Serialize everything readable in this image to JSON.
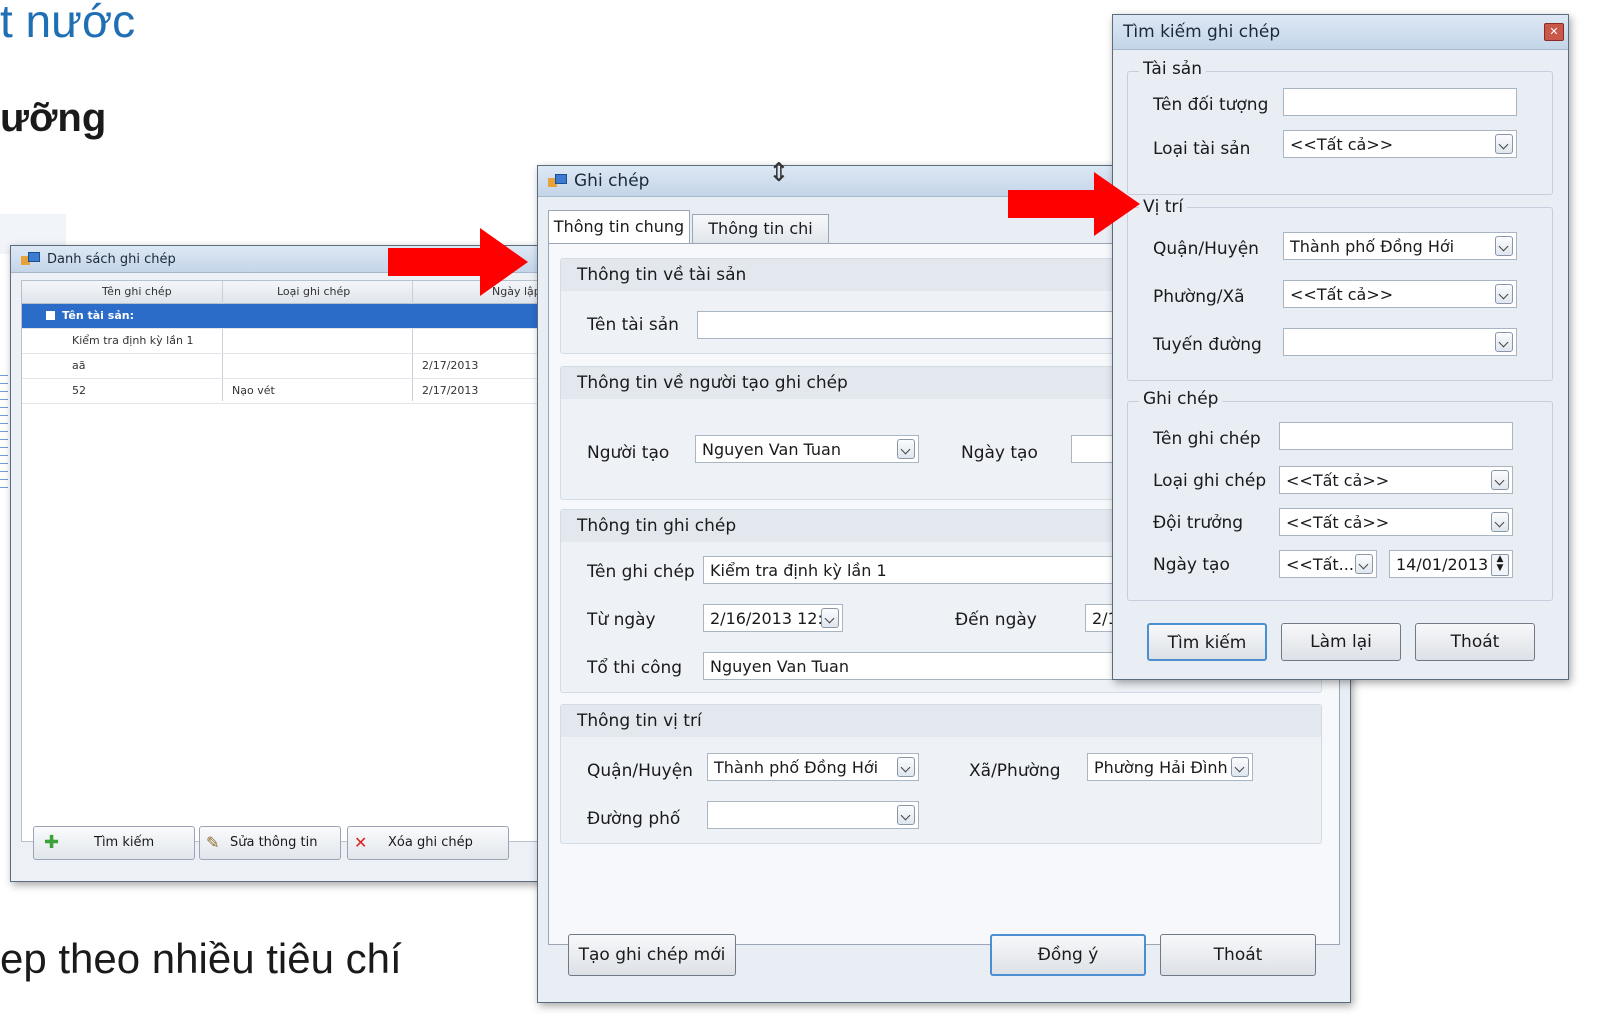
{
  "slide": {
    "title": "t nước",
    "subtitle": "ưỡng",
    "bottom_text": "ep theo nhiều tiêu chí"
  },
  "list_window": {
    "title": "Danh sách ghi chép",
    "columns": [
      "Tên ghi chép",
      "Loại ghi chép",
      "Ngày lập"
    ],
    "group_row": "Tên tài sản:",
    "rows": [
      {
        "name": "Kiểm tra định kỳ lần 1",
        "type": "",
        "date": ""
      },
      {
        "name": "aã",
        "type": "",
        "date": "2/17/2013"
      },
      {
        "name": "52",
        "type": "Nạo vét",
        "date": "2/17/2013"
      }
    ],
    "buttons": {
      "search": "Tìm kiếm",
      "edit": "Sửa thông tin",
      "delete": "Xóa ghi chép"
    }
  },
  "record_window": {
    "title": "Ghi chép",
    "tabs": [
      "Thông tin chung",
      "Thông tin chi tiết"
    ],
    "section_asset": "Thông tin về tài sản",
    "asset_name_label": "Tên tài sản",
    "asset_name_value": "",
    "section_creator": "Thông tin về người tạo ghi chép",
    "creator_label": "Người tạo",
    "creator_value": "Nguyen Van Tuan",
    "created_date_label": "Ngày tạo",
    "section_record": "Thông tin ghi chép",
    "record_name_label": "Tên ghi chép",
    "record_name_value": "Kiểm tra định kỳ lần 1",
    "from_label": "Từ ngày",
    "from_value": "2/16/2013 12:",
    "to_label": "Đến ngày",
    "to_value": "2/1",
    "team_label": "Tổ thi công",
    "team_value": "Nguyen Van Tuan",
    "section_location": "Thông tin vị trí",
    "district_label": "Quận/Huyện",
    "district_value": "Thành phố Đồng Hới",
    "ward_label": "Xã/Phường",
    "ward_value": "Phường Hải Đình",
    "street_label": "Đường phố",
    "street_value": "",
    "btn_new": "Tạo ghi chép mới",
    "btn_ok": "Đồng ý",
    "btn_exit": "Thoát"
  },
  "search_window": {
    "title": "Tìm kiếm ghi chép",
    "group_asset": "Tài sản",
    "object_name_label": "Tên đối tượng",
    "object_name_value": "",
    "asset_type_label": "Loại tài sản",
    "asset_type_value": "<<Tất cả>>",
    "group_location": "Vị trí",
    "district_label": "Quận/Huyện",
    "district_value": "Thành phố Đồng Hới",
    "ward_label": "Phường/Xã",
    "ward_value": "<<Tất cả>>",
    "route_label": "Tuyến đường",
    "route_value": "",
    "group_record": "Ghi chép",
    "record_name_label": "Tên ghi chép",
    "record_name_value": "",
    "record_type_label": "Loại ghi chép",
    "record_type_value": "<<Tất cả>>",
    "team_lead_label": "Đội trưởng",
    "team_lead_value": "<<Tất cả>>",
    "created_label": "Ngày tạo",
    "created_mode_value": "<<Tất...",
    "created_date_value": "14/01/2013",
    "btn_search": "Tìm kiếm",
    "btn_reset": "Làm lại",
    "btn_exit": "Thoát"
  },
  "colors": {
    "arrow": "#ff0000",
    "title_blue": "#1f6fb5",
    "selection": "#2c6cc9"
  }
}
